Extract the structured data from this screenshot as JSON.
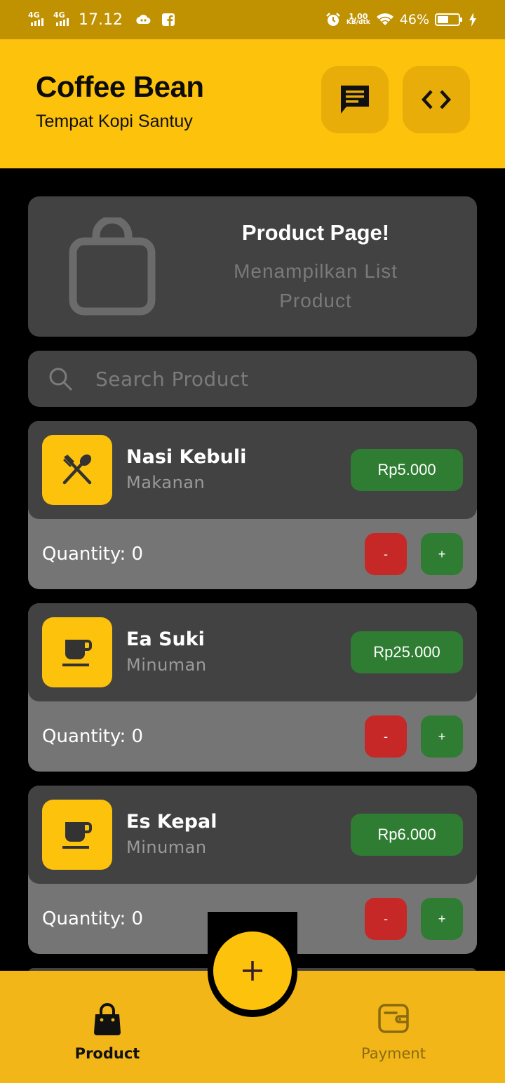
{
  "status_bar": {
    "network_1": "4G",
    "network_2": "4G",
    "time": "17.12",
    "speed_value": "1,00",
    "speed_unit": "KB/dtk",
    "battery": "46%",
    "icons": [
      "signal-icon",
      "cloud-game-icon",
      "facebook-icon",
      "alarm-icon",
      "wifi-icon",
      "battery-icon",
      "charging-icon"
    ]
  },
  "header": {
    "title": "Coffee Bean",
    "subtitle": "Tempat Kopi Santuy",
    "buttons": [
      "chat-icon",
      "code-icon"
    ]
  },
  "banner": {
    "title": "Product Page!",
    "description": "Menampilkan List Product",
    "icon": "shopping-bag-icon"
  },
  "search": {
    "placeholder": "Search Product",
    "value": ""
  },
  "products": [
    {
      "name": "Nasi Kebuli",
      "category": "Makanan",
      "price": "Rp5.000",
      "quantity": "Quantity: 0",
      "minus": "-",
      "plus": "+",
      "icon": "restaurant-icon"
    },
    {
      "name": "Ea Suki",
      "category": "Minuman",
      "price": "Rp25.000",
      "quantity": "Quantity: 0",
      "minus": "-",
      "plus": "+",
      "icon": "coffee-icon"
    },
    {
      "name": "Es Kepal",
      "category": "Minuman",
      "price": "Rp6.000",
      "quantity": "Quantity: 0",
      "minus": "-",
      "plus": "+",
      "icon": "coffee-icon"
    }
  ],
  "fab": {
    "icon": "plus-icon"
  },
  "bottom_nav": {
    "items": [
      {
        "label": "Product",
        "icon": "shopping-bag-icon",
        "active": true
      },
      {
        "label": "Payment",
        "icon": "wallet-icon",
        "active": false
      }
    ]
  },
  "colors": {
    "accent": "#fdc20c",
    "status_bar": "#c09100",
    "card": "#424242",
    "card_footer": "#757575",
    "green": "#2e7d32",
    "red": "#c62828",
    "nav": "#f2b619",
    "inactive": "#8a6a10"
  }
}
